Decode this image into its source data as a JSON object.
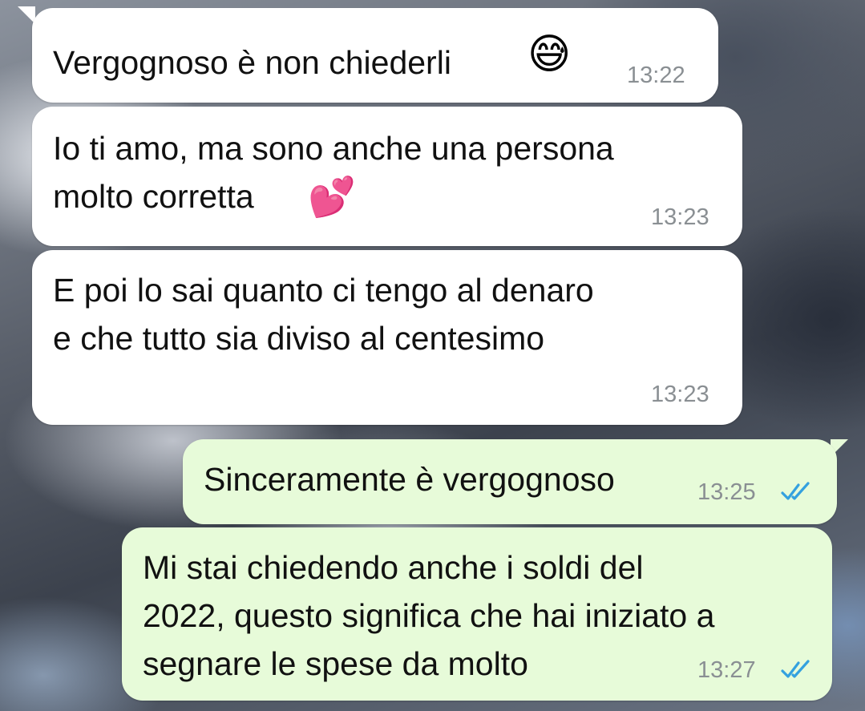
{
  "messages": [
    {
      "direction": "incoming",
      "text": "Vergognoso è non chiederli",
      "emoji": "😅",
      "emoji_name": "sweat-smile-icon",
      "time": "13:22"
    },
    {
      "direction": "incoming",
      "text": "Io ti amo, ma sono anche una persona\nmolto corretta",
      "emoji": "💕",
      "emoji_name": "two-hearts-icon",
      "time": "13:23"
    },
    {
      "direction": "incoming",
      "text": "E poi lo sai quanto ci tengo al denaro\ne che tutto sia diviso al centesimo",
      "time": "13:23"
    },
    {
      "direction": "outgoing",
      "text": "Sinceramente è vergognoso",
      "time": "13:25",
      "status": "read"
    },
    {
      "direction": "outgoing",
      "text": "Mi stai chiedendo anche i soldi del\n2022, questo significa che hai iniziato a\nsegnare le spese da molto",
      "time": "13:27",
      "status": "read"
    }
  ],
  "colors": {
    "incoming_bubble": "#ffffff",
    "outgoing_bubble": "#e7fbd9",
    "timestamp": "#8a8f93",
    "read_ticks": "#34a1df"
  }
}
